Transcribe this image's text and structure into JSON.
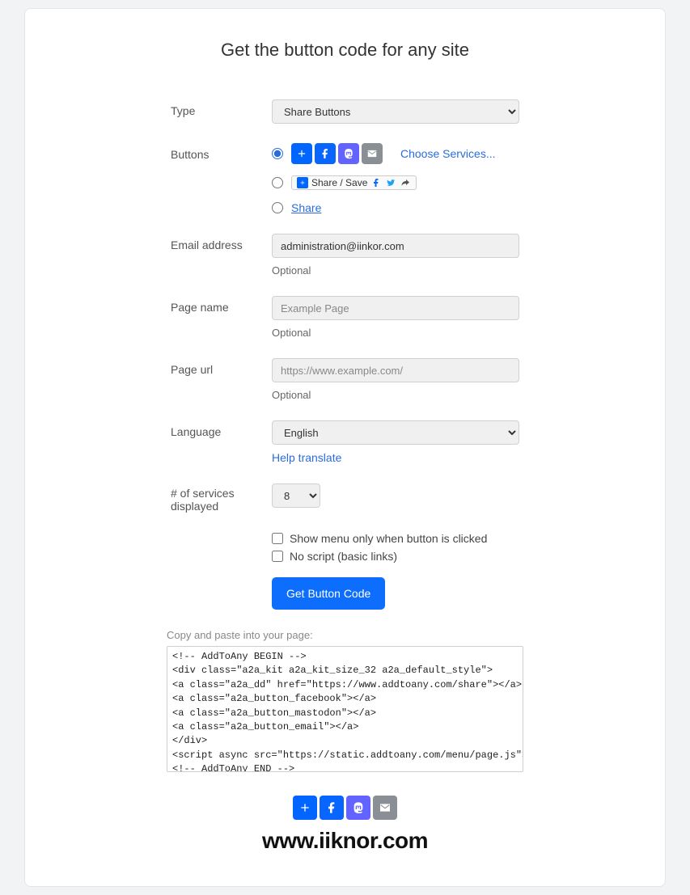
{
  "title": "Get the button code for any site",
  "labels": {
    "type": "Type",
    "buttons": "Buttons",
    "email": "Email address",
    "page_name": "Page name",
    "page_url": "Page url",
    "language": "Language",
    "services": "# of services displayed"
  },
  "type_options": {
    "selected": "Share Buttons"
  },
  "buttons": {
    "choose_services": "Choose Services...",
    "share_save_text": "Share / Save",
    "share_only": "Share"
  },
  "email": {
    "value": "administration@iinkor.com",
    "hint": "Optional"
  },
  "page_name": {
    "placeholder": "Example Page",
    "hint": "Optional"
  },
  "page_url": {
    "placeholder": "https://www.example.com/",
    "hint": "Optional"
  },
  "language": {
    "selected": "English",
    "help_link": "Help translate"
  },
  "services": {
    "selected": "8"
  },
  "checkboxes": {
    "show_menu": "Show menu only when button is clicked",
    "no_script": "No script (basic links)"
  },
  "submit": "Get Button Code",
  "code": {
    "label": "Copy and paste into your page:",
    "value": "<!-- AddToAny BEGIN -->\n<div class=\"a2a_kit a2a_kit_size_32 a2a_default_style\">\n<a class=\"a2a_dd\" href=\"https://www.addtoany.com/share\"></a>\n<a class=\"a2a_button_facebook\"></a>\n<a class=\"a2a_button_mastodon\"></a>\n<a class=\"a2a_button_email\"></a>\n</div>\n<script async src=\"https://static.addtoany.com/menu/page.js\"></script>\n<!-- AddToAny END -->"
  },
  "footer": {
    "site": "www.iiknor.com"
  }
}
